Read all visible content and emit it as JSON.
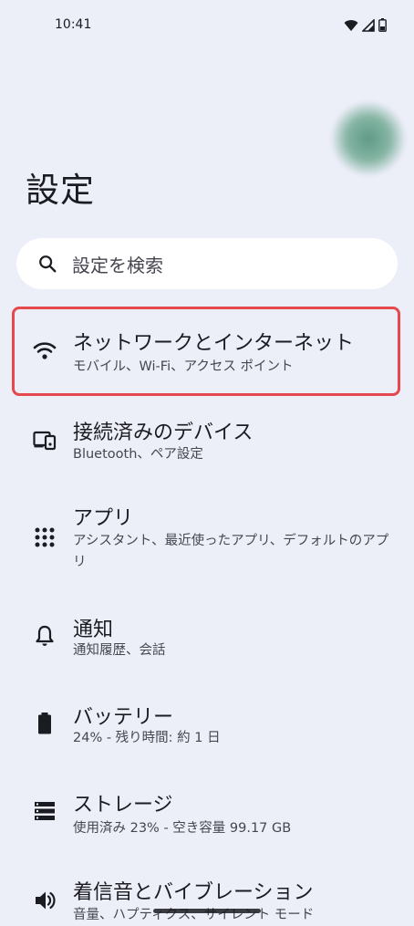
{
  "status_bar": {
    "time": "10:41",
    "icons": [
      "wifi-icon",
      "signal-icon",
      "battery-icon"
    ]
  },
  "header": {
    "title": "設定"
  },
  "search": {
    "placeholder": "設定を検索"
  },
  "settings": [
    {
      "icon": "wifi-icon",
      "title": "ネットワークとインターネット",
      "subtitle": "モバイル、Wi-Fi、アクセス ポイント"
    },
    {
      "icon": "devices-icon",
      "title": "接続済みのデバイス",
      "subtitle": "Bluetooth、ペア設定"
    },
    {
      "icon": "apps-grid-icon",
      "title": "アプリ",
      "subtitle": "アシスタント、最近使ったアプリ、デフォルトのアプリ"
    },
    {
      "icon": "bell-icon",
      "title": "通知",
      "subtitle": "通知履歴、会話"
    },
    {
      "icon": "battery-icon",
      "title": "バッテリー",
      "subtitle": "24% - 残り時間: 約 1 日"
    },
    {
      "icon": "storage-icon",
      "title": "ストレージ",
      "subtitle": "使用済み 23% - 空き容量 99.17 GB"
    },
    {
      "icon": "volume-icon",
      "title": "着信音とバイブレーション",
      "subtitle": "音量、ハプティクス、サイレント モード"
    }
  ],
  "colors": {
    "background": "#eceef8",
    "highlight": "#e5484d",
    "text_primary": "#1b1c22",
    "text_secondary": "#45464f"
  }
}
